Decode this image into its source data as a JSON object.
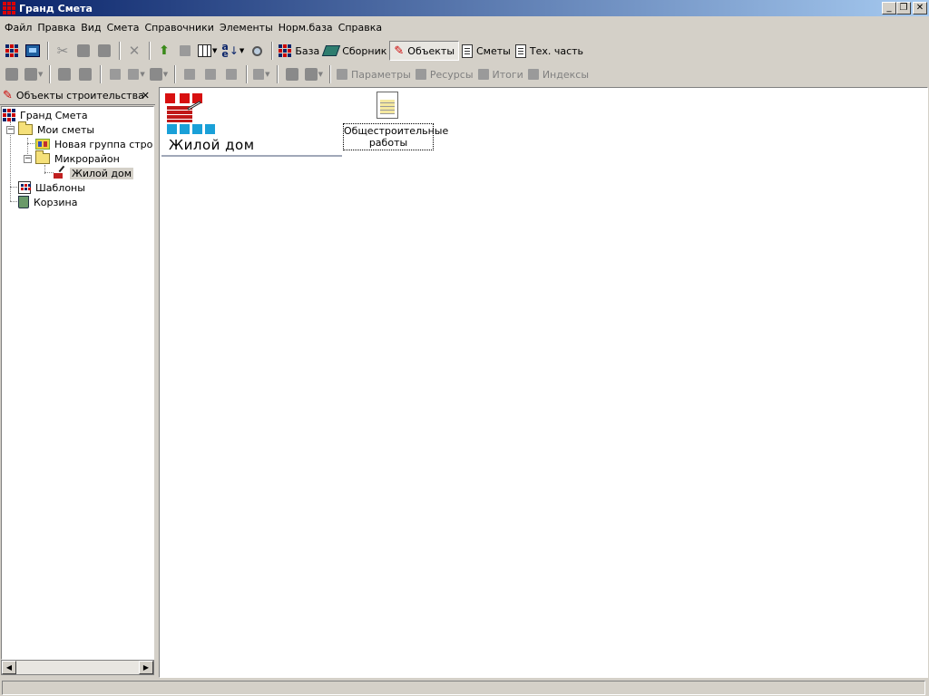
{
  "window": {
    "title": "Гранд Смета"
  },
  "menu": [
    "Файл",
    "Правка",
    "Вид",
    "Смета",
    "Справочники",
    "Элементы",
    "Норм.база",
    "Справка"
  ],
  "toolbar1": {
    "base_label": "База",
    "collection_label": "Сборник",
    "objects_label": "Объекты",
    "estimates_label": "Сметы",
    "tech_part_label": "Тех. часть"
  },
  "toolbar2": {
    "params_label": "Параметры",
    "resources_label": "Ресурсы",
    "totals_label": "Итоги",
    "indexes_label": "Индексы"
  },
  "tree_panel": {
    "title": "Объекты строительства",
    "nodes": [
      "Гранд Смета",
      "Мои сметы",
      "Новая группа строек",
      "Микрорайон",
      "Жилой дом",
      "Шаблоны",
      "Корзина"
    ]
  },
  "main": {
    "object_title": "Жилой дом",
    "items": [
      {
        "label": "Общестроительные работы"
      }
    ]
  },
  "colors": {
    "titlebar_start": "#0a246a",
    "titlebar_end": "#a6caf0",
    "window_bg": "#d4d0c8"
  }
}
